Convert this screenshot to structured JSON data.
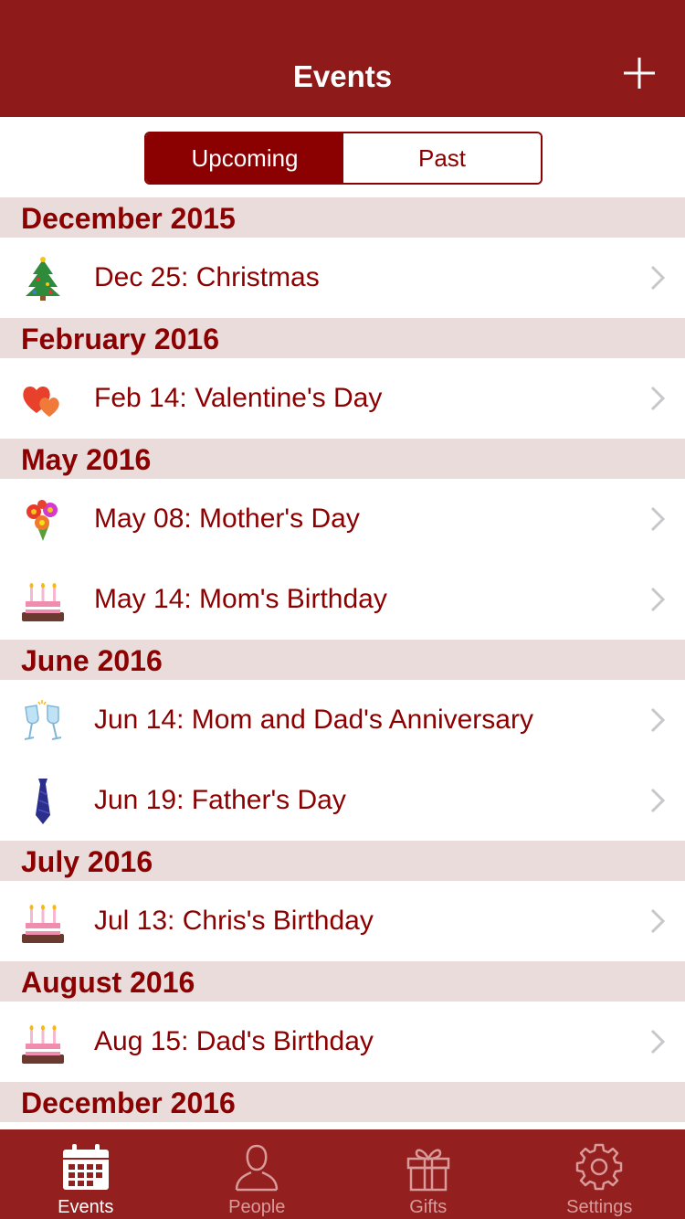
{
  "navbar": {
    "title": "Events",
    "add_icon": "plus-icon"
  },
  "segments": [
    {
      "label": "Upcoming",
      "active": true
    },
    {
      "label": "Past",
      "active": false
    }
  ],
  "sections": [
    {
      "header": "December 2015",
      "items": [
        {
          "label": "Dec 25: Christmas",
          "icon": "christmas-tree-icon"
        }
      ]
    },
    {
      "header": "February 2016",
      "items": [
        {
          "label": "Feb 14: Valentine's Day",
          "icon": "hearts-icon"
        }
      ]
    },
    {
      "header": "May 2016",
      "items": [
        {
          "label": "May 08: Mother's Day",
          "icon": "bouquet-icon"
        },
        {
          "label": "May 14: Mom's Birthday",
          "icon": "birthday-cake-icon"
        }
      ]
    },
    {
      "header": "June 2016",
      "items": [
        {
          "label": "Jun 14: Mom and Dad's Anniversary",
          "icon": "champagne-glasses-icon"
        },
        {
          "label": "Jun 19: Father's Day",
          "icon": "necktie-icon"
        }
      ]
    },
    {
      "header": "July 2016",
      "items": [
        {
          "label": "Jul 13: Chris's Birthday",
          "icon": "birthday-cake-icon"
        }
      ]
    },
    {
      "header": "August 2016",
      "items": [
        {
          "label": "Aug 15: Dad's Birthday",
          "icon": "birthday-cake-icon"
        }
      ]
    },
    {
      "header": "December 2016",
      "items": []
    }
  ],
  "tabs": [
    {
      "label": "Events",
      "icon": "calendar-icon",
      "active": true
    },
    {
      "label": "People",
      "icon": "person-icon",
      "active": false
    },
    {
      "label": "Gifts",
      "icon": "gift-icon",
      "active": false
    },
    {
      "label": "Settings",
      "icon": "gear-icon",
      "active": false
    }
  ],
  "colors": {
    "primary": "#8b0000",
    "navbar": "#8f1a1a",
    "section_bg": "#ebdcdc",
    "tab_inactive": "#d99a9a"
  }
}
